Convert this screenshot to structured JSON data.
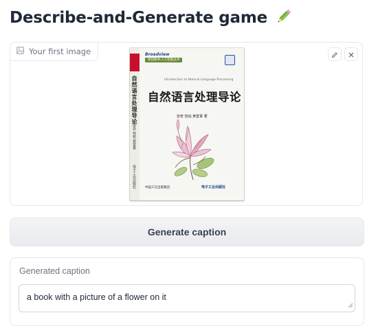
{
  "page": {
    "title": "Describe-and-Generate game"
  },
  "image_input": {
    "label": "Your first image",
    "book": {
      "brand": "Broadview",
      "series": "新知图书·人工智能丛书",
      "english_subtitle": "Introduction to Natural Language Processing",
      "title": "自然语言处理导论",
      "spine_title": "自然语言处理导论",
      "authors": "张奇 桂韬 黄萱菁 著",
      "spine_authors": "张奇 桂韬 黄萱菁",
      "publisher_left": "中国工信出版集团",
      "publisher_right": "电子工业出版社"
    }
  },
  "generate_button": {
    "label": "Generate caption"
  },
  "caption_output": {
    "label": "Generated caption",
    "value": "a book with a picture of a flower on it"
  },
  "colors": {
    "spine_red": "#c8102e",
    "series_badge": "#6a8a3a",
    "border": "#e5e7eb",
    "label_text": "#6b7280"
  }
}
